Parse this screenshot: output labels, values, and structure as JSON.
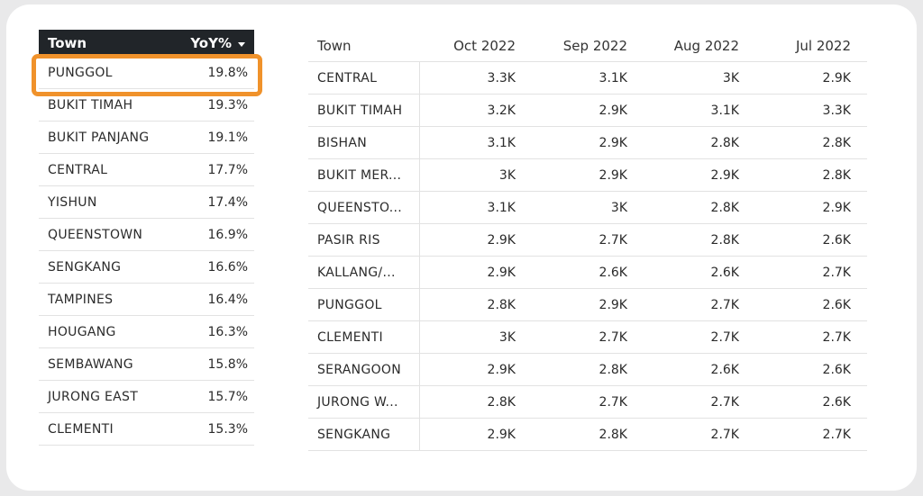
{
  "left_table": {
    "header": {
      "town": "Town",
      "yoy": "YoY%"
    },
    "rows": [
      {
        "town": "PUNGGOL",
        "yoy": "19.8%"
      },
      {
        "town": "BUKIT TIMAH",
        "yoy": "19.3%"
      },
      {
        "town": "BUKIT PANJANG",
        "yoy": "19.1%"
      },
      {
        "town": "CENTRAL",
        "yoy": "17.7%"
      },
      {
        "town": "YISHUN",
        "yoy": "17.4%"
      },
      {
        "town": "QUEENSTOWN",
        "yoy": "16.9%"
      },
      {
        "town": "SENGKANG",
        "yoy": "16.6%"
      },
      {
        "town": "TAMPINES",
        "yoy": "16.4%"
      },
      {
        "town": "HOUGANG",
        "yoy": "16.3%"
      },
      {
        "town": "SEMBAWANG",
        "yoy": "15.8%"
      },
      {
        "town": "JURONG EAST",
        "yoy": "15.7%"
      },
      {
        "town": "CLEMENTI",
        "yoy": "15.3%"
      }
    ]
  },
  "right_table": {
    "headers": [
      "Town",
      "Oct 2022",
      "Sep 2022",
      "Aug 2022",
      "Jul 2022"
    ],
    "rows": [
      [
        "CENTRAL",
        "3.3K",
        "3.1K",
        "3K",
        "2.9K"
      ],
      [
        "BUKIT TIMAH",
        "3.2K",
        "2.9K",
        "3.1K",
        "3.3K"
      ],
      [
        "BISHAN",
        "3.1K",
        "2.9K",
        "2.8K",
        "2.8K"
      ],
      [
        "BUKIT MER...",
        "3K",
        "2.9K",
        "2.9K",
        "2.8K"
      ],
      [
        "QUEENSTO...",
        "3.1K",
        "3K",
        "2.8K",
        "2.9K"
      ],
      [
        "PASIR RIS",
        "2.9K",
        "2.7K",
        "2.8K",
        "2.6K"
      ],
      [
        "KALLANG/...",
        "2.9K",
        "2.6K",
        "2.6K",
        "2.7K"
      ],
      [
        "PUNGGOL",
        "2.8K",
        "2.9K",
        "2.7K",
        "2.6K"
      ],
      [
        "CLEMENTI",
        "3K",
        "2.7K",
        "2.7K",
        "2.7K"
      ],
      [
        "SERANGOON",
        "2.9K",
        "2.8K",
        "2.6K",
        "2.6K"
      ],
      [
        "JURONG W...",
        "2.8K",
        "2.7K",
        "2.7K",
        "2.6K"
      ],
      [
        "SENGKANG",
        "2.9K",
        "2.8K",
        "2.7K",
        "2.7K"
      ]
    ]
  },
  "colors": {
    "header_bg": "#212529",
    "highlight": "#f0922b",
    "card": "#ffffff",
    "page_bg": "#e9e9ea"
  },
  "icons": {
    "sort_indicator": "caret-down-icon"
  }
}
